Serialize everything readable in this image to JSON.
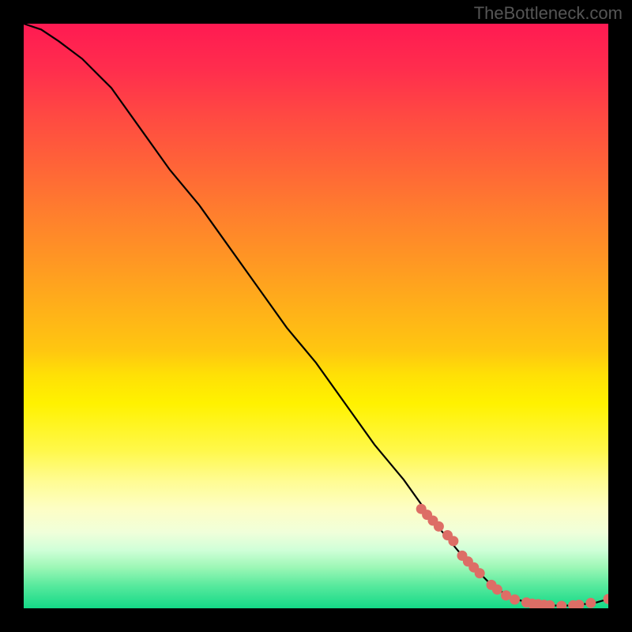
{
  "watermark": "TheBottleneck.com",
  "chart_data": {
    "type": "line",
    "title": "",
    "xlabel": "",
    "ylabel": "",
    "xlim": [
      0,
      100
    ],
    "ylim": [
      0,
      100
    ],
    "grid": false,
    "legend": false,
    "background_gradient": {
      "top": "#ff1a52",
      "middle": "#fff200",
      "bottom": "#14d987",
      "description": "red-to-yellow-to-green vertical gradient"
    },
    "series": [
      {
        "name": "bottleneck-curve",
        "color": "#000000",
        "x": [
          0,
          3,
          6,
          10,
          15,
          20,
          25,
          30,
          35,
          40,
          45,
          50,
          55,
          60,
          65,
          70,
          75,
          80,
          83,
          86,
          89,
          92,
          95,
          98,
          100
        ],
        "y": [
          100,
          99,
          97,
          94,
          89,
          82,
          75,
          69,
          62,
          55,
          48,
          42,
          35,
          28,
          22,
          15,
          9,
          4,
          2,
          1,
          0.6,
          0.4,
          0.6,
          1.0,
          1.6
        ]
      }
    ],
    "markers": {
      "name": "highlighted-points",
      "color": "#dd6e66",
      "radius": 6.5,
      "points": [
        {
          "x": 68,
          "y": 17
        },
        {
          "x": 69,
          "y": 16
        },
        {
          "x": 70,
          "y": 15
        },
        {
          "x": 71,
          "y": 14
        },
        {
          "x": 72.5,
          "y": 12.5
        },
        {
          "x": 73.5,
          "y": 11.5
        },
        {
          "x": 75,
          "y": 9
        },
        {
          "x": 76,
          "y": 8
        },
        {
          "x": 77,
          "y": 7
        },
        {
          "x": 78,
          "y": 6
        },
        {
          "x": 80,
          "y": 4
        },
        {
          "x": 81,
          "y": 3.2
        },
        {
          "x": 82.5,
          "y": 2.2
        },
        {
          "x": 84,
          "y": 1.5
        },
        {
          "x": 86,
          "y": 1.0
        },
        {
          "x": 87,
          "y": 0.8
        },
        {
          "x": 88,
          "y": 0.7
        },
        {
          "x": 89,
          "y": 0.6
        },
        {
          "x": 90,
          "y": 0.5
        },
        {
          "x": 92,
          "y": 0.4
        },
        {
          "x": 94,
          "y": 0.5
        },
        {
          "x": 95,
          "y": 0.6
        },
        {
          "x": 97,
          "y": 0.9
        },
        {
          "x": 100,
          "y": 1.6
        }
      ]
    }
  }
}
